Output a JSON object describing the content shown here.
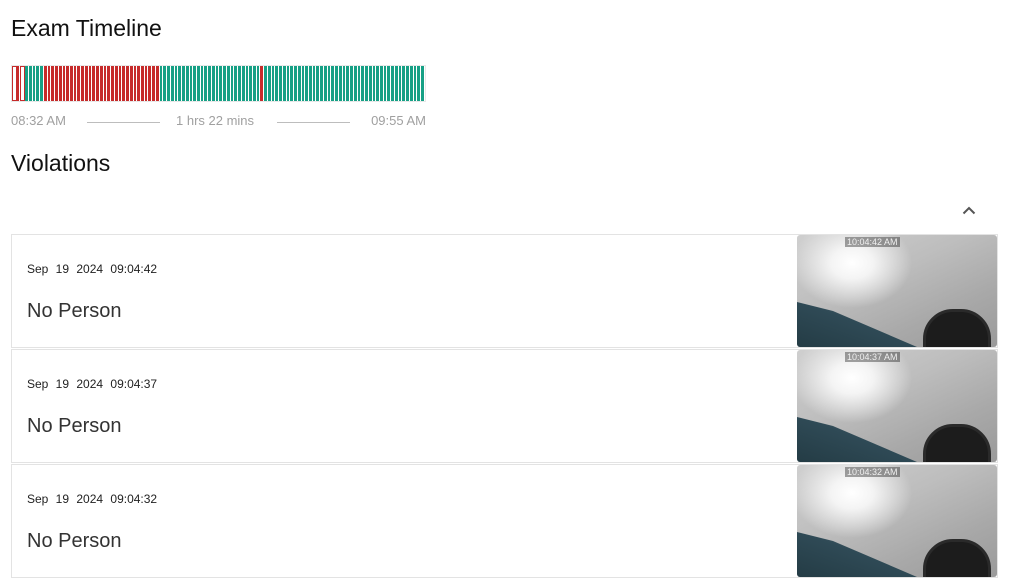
{
  "timeline": {
    "title": "Exam Timeline",
    "start_time": "08:32 AM",
    "duration": "1 hrs 22 mins",
    "end_time": "09:55 AM",
    "colors": {
      "ok": "#16a085",
      "violation": "#c62b2b"
    },
    "segments": [
      "empty",
      "bad",
      "empty",
      "ok",
      "ok",
      "ok",
      "ok",
      "ok",
      "bad",
      "bad",
      "bad",
      "bad",
      "bad",
      "bad",
      "bad",
      "bad",
      "bad",
      "bad",
      "bad",
      "bad",
      "bad",
      "bad",
      "bad",
      "bad",
      "bad",
      "bad",
      "bad",
      "bad",
      "bad",
      "bad",
      "bad",
      "bad",
      "bad",
      "bad",
      "bad",
      "bad",
      "bad",
      "bad",
      "bad",
      "ok",
      "ok",
      "ok",
      "ok",
      "ok",
      "ok",
      "ok",
      "ok",
      "ok",
      "ok",
      "ok",
      "ok",
      "ok",
      "ok",
      "ok",
      "ok",
      "ok",
      "ok",
      "ok",
      "ok",
      "ok",
      "ok",
      "ok",
      "ok",
      "ok",
      "ok",
      "ok",
      "bad",
      "ok",
      "ok",
      "ok",
      "ok",
      "ok",
      "ok",
      "ok",
      "ok",
      "ok",
      "ok",
      "ok",
      "ok",
      "ok",
      "ok",
      "ok",
      "ok",
      "ok",
      "ok",
      "ok",
      "ok",
      "ok",
      "ok",
      "ok",
      "ok",
      "ok",
      "ok",
      "ok",
      "ok",
      "ok",
      "ok",
      "ok",
      "ok",
      "ok",
      "ok",
      "ok",
      "ok",
      "ok",
      "ok",
      "ok",
      "ok",
      "ok",
      "ok",
      "ok"
    ]
  },
  "violations": {
    "title": "Violations",
    "collapse_icon": "chevron-up-icon",
    "items": [
      {
        "date": "Sep 19 2024 09:04:42",
        "type": "No Person",
        "stamp": "10:04:42 AM"
      },
      {
        "date": "Sep 19 2024 09:04:37",
        "type": "No Person",
        "stamp": "10:04:37 AM"
      },
      {
        "date": "Sep 19 2024 09:04:32",
        "type": "No Person",
        "stamp": "10:04:32 AM"
      }
    ]
  }
}
